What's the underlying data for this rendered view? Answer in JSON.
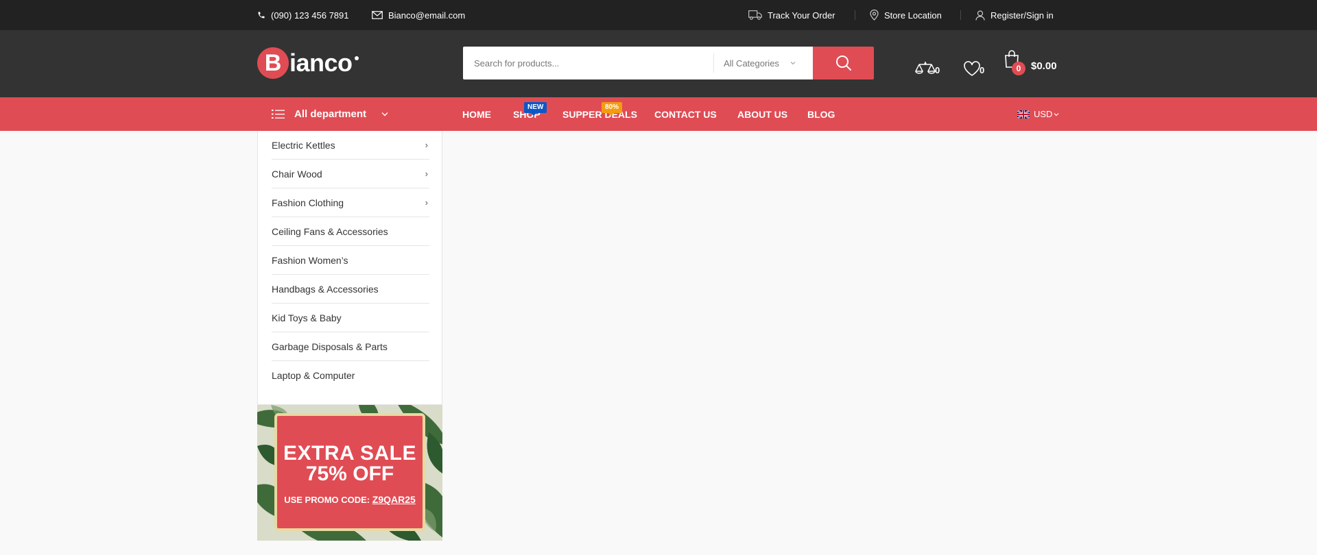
{
  "topbar": {
    "phone": "(090) 123 456 7891",
    "email": "Bianco@email.com",
    "track_order": "Track Your Order",
    "store_location": "Store Location",
    "register": "Register/Sign in"
  },
  "header": {
    "logo_letter": "B",
    "logo_text": "ianco",
    "search": {
      "placeholder": "Search for products..."
    },
    "category_select": "All Categories",
    "compare_count": "0",
    "wishlist_count": "0",
    "cart_count": "0",
    "cart_total": "$0.00"
  },
  "nav": {
    "department_label": "All department",
    "items": [
      {
        "label": "HOME"
      },
      {
        "label": "SHOP",
        "badge": "NEW"
      },
      {
        "label": "SUPPER DEALS",
        "badge": "80%"
      },
      {
        "label": "CONTACT US"
      },
      {
        "label": "ABOUT US"
      },
      {
        "label": "BLOG"
      }
    ],
    "currency": "USD"
  },
  "departments": [
    {
      "label": "Electric Kettles",
      "has_submenu": true
    },
    {
      "label": "Chair Wood",
      "has_submenu": true
    },
    {
      "label": "Fashion Clothing",
      "has_submenu": true
    },
    {
      "label": "Ceiling Fans & Accessories",
      "has_submenu": false
    },
    {
      "label": "Fashion Women’s",
      "has_submenu": false
    },
    {
      "label": "Handbags & Accessories",
      "has_submenu": false
    },
    {
      "label": "Kid Toys & Baby",
      "has_submenu": false
    },
    {
      "label": "Garbage Disposals & Parts",
      "has_submenu": false
    },
    {
      "label": "Laptop & Computer",
      "has_submenu": false
    }
  ],
  "promo": {
    "line1": "EXTRA SALE",
    "line2": "75% OFF",
    "code_label": "USE PROMO CODE:",
    "code": "Z9QAR25"
  },
  "colors": {
    "accent": "#e04c54",
    "topbar_bg": "#222222",
    "header_bg": "#333333",
    "badge_new": "#0d57c6",
    "badge_deal": "#f39c12"
  }
}
